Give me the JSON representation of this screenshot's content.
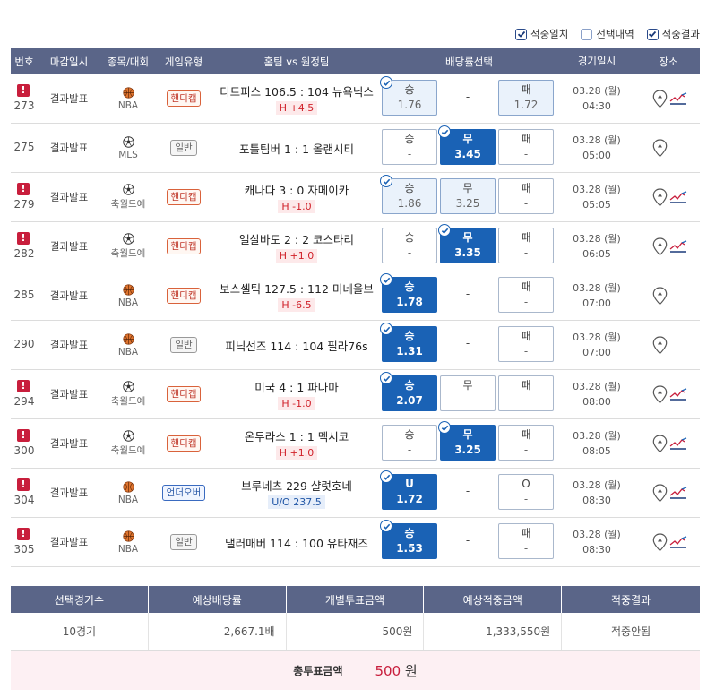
{
  "legend": [
    {
      "label": "적중일치",
      "checked": true
    },
    {
      "label": "선택내역",
      "checked": false
    },
    {
      "label": "적중결과",
      "checked": true
    }
  ],
  "headers": [
    "번호",
    "마감일시",
    "종목/대회",
    "게임유형",
    "홈팀 vs 원정팀",
    "배당률선택",
    "경기일시",
    "장소"
  ],
  "rows": [
    {
      "no": "273",
      "warn": "!",
      "state": "결과발표",
      "sport": "basketball",
      "league": "NBA",
      "type": "핸디캡",
      "typeStyle": "handi",
      "match": "디트피스 106.5 : 104 뉴욕닉스",
      "line": "H +4.5",
      "lineStyle": "red",
      "win": {
        "label": "승",
        "value": "1.76",
        "style": "pick",
        "check": true
      },
      "draw": {
        "label": "-",
        "value": ""
      },
      "lose": {
        "label": "패",
        "value": "1.72",
        "style": "pick",
        "check": false
      },
      "date": "03.28 (월)",
      "time": "04:30",
      "trend": true
    },
    {
      "no": "275",
      "warn": "",
      "state": "결과발표",
      "sport": "soccer",
      "league": "MLS",
      "type": "일반",
      "typeStyle": "normal",
      "match": "포틀팀버 1 : 1 올랜시티",
      "line": "",
      "lineStyle": "",
      "win": {
        "label": "승",
        "value": "-",
        "style": "",
        "check": false
      },
      "draw": {
        "label": "무",
        "value": "3.45",
        "style": "sel",
        "check": true
      },
      "lose": {
        "label": "패",
        "value": "-",
        "style": "",
        "check": false
      },
      "date": "03.28 (월)",
      "time": "05:00",
      "trend": false
    },
    {
      "no": "279",
      "warn": "!",
      "state": "결과발표",
      "sport": "soccer",
      "league": "축월드예",
      "type": "핸디캡",
      "typeStyle": "handi",
      "match": "캐나다 3 : 0 자메이카",
      "line": "H -1.0",
      "lineStyle": "red",
      "win": {
        "label": "승",
        "value": "1.86",
        "style": "pick",
        "check": true
      },
      "draw": {
        "label": "무",
        "value": "3.25",
        "style": "pick",
        "check": false
      },
      "lose": {
        "label": "패",
        "value": "-",
        "style": "",
        "check": false
      },
      "date": "03.28 (월)",
      "time": "05:05",
      "trend": true
    },
    {
      "no": "282",
      "warn": "!",
      "state": "결과발표",
      "sport": "soccer",
      "league": "축월드예",
      "type": "핸디캡",
      "typeStyle": "handi",
      "match": "엘살바도 2 : 2 코스타리",
      "line": "H +1.0",
      "lineStyle": "red",
      "win": {
        "label": "승",
        "value": "-",
        "style": "",
        "check": false
      },
      "draw": {
        "label": "무",
        "value": "3.35",
        "style": "sel",
        "check": true
      },
      "lose": {
        "label": "패",
        "value": "-",
        "style": "",
        "check": false
      },
      "date": "03.28 (월)",
      "time": "06:05",
      "trend": true
    },
    {
      "no": "285",
      "warn": "",
      "state": "결과발표",
      "sport": "basketball",
      "league": "NBA",
      "type": "핸디캡",
      "typeStyle": "handi",
      "match": "보스셀틱 127.5 : 112 미네울브",
      "line": "H -6.5",
      "lineStyle": "red",
      "win": {
        "label": "승",
        "value": "1.78",
        "style": "sel",
        "check": true
      },
      "draw": {
        "label": "-",
        "value": ""
      },
      "lose": {
        "label": "패",
        "value": "-",
        "style": "",
        "check": false
      },
      "date": "03.28 (월)",
      "time": "07:00",
      "trend": false
    },
    {
      "no": "290",
      "warn": "",
      "state": "결과발표",
      "sport": "basketball",
      "league": "NBA",
      "type": "일반",
      "typeStyle": "normal",
      "match": "피닉선즈 114 : 104 필라76s",
      "line": "",
      "lineStyle": "",
      "win": {
        "label": "승",
        "value": "1.31",
        "style": "sel",
        "check": true
      },
      "draw": {
        "label": "-",
        "value": ""
      },
      "lose": {
        "label": "패",
        "value": "-",
        "style": "",
        "check": false
      },
      "date": "03.28 (월)",
      "time": "07:00",
      "trend": false
    },
    {
      "no": "294",
      "warn": "!",
      "state": "결과발표",
      "sport": "soccer",
      "league": "축월드예",
      "type": "핸디캡",
      "typeStyle": "handi",
      "match": "미국 4 : 1 파나마",
      "line": "H -1.0",
      "lineStyle": "red",
      "win": {
        "label": "승",
        "value": "2.07",
        "style": "sel",
        "check": true
      },
      "draw": {
        "label": "무",
        "value": "-",
        "style": "",
        "check": false
      },
      "lose": {
        "label": "패",
        "value": "-",
        "style": "",
        "check": false
      },
      "date": "03.28 (월)",
      "time": "08:00",
      "trend": true
    },
    {
      "no": "300",
      "warn": "!",
      "state": "결과발표",
      "sport": "soccer",
      "league": "축월드예",
      "type": "핸디캡",
      "typeStyle": "handi",
      "match": "온두라스 1 : 1 멕시코",
      "line": "H +1.0",
      "lineStyle": "red",
      "win": {
        "label": "승",
        "value": "-",
        "style": "",
        "check": false
      },
      "draw": {
        "label": "무",
        "value": "3.25",
        "style": "sel",
        "check": true
      },
      "lose": {
        "label": "패",
        "value": "-",
        "style": "",
        "check": false
      },
      "date": "03.28 (월)",
      "time": "08:05",
      "trend": true
    },
    {
      "no": "304",
      "warn": "!",
      "state": "결과발표",
      "sport": "basketball",
      "league": "NBA",
      "type": "언더오버",
      "typeStyle": "ou",
      "match": "브루네츠  229  샬럿호네",
      "line": "U/O 237.5",
      "lineStyle": "blue",
      "win": {
        "label": "U",
        "value": "1.72",
        "style": "sel",
        "check": true
      },
      "draw": {
        "label": "-",
        "value": ""
      },
      "lose": {
        "label": "O",
        "value": "-",
        "style": "",
        "check": false
      },
      "date": "03.28 (월)",
      "time": "08:30",
      "trend": true
    },
    {
      "no": "305",
      "warn": "!",
      "state": "결과발표",
      "sport": "basketball",
      "league": "NBA",
      "type": "일반",
      "typeStyle": "normal",
      "match": "댈러매버 114 : 100 유타재즈",
      "line": "",
      "lineStyle": "",
      "win": {
        "label": "승",
        "value": "1.53",
        "style": "sel",
        "check": true
      },
      "draw": {
        "label": "-",
        "value": ""
      },
      "lose": {
        "label": "패",
        "value": "-",
        "style": "",
        "check": false
      },
      "date": "03.28 (월)",
      "time": "08:30",
      "trend": true
    }
  ],
  "summary": {
    "headers": [
      "선택경기수",
      "예상배당률",
      "개별투표금액",
      "예상적중금액",
      "적중결과"
    ],
    "values": [
      "10경기",
      "2,667.1배",
      "500원",
      "1,333,550원",
      "적중안됨"
    ],
    "total_label": "총투표금액",
    "total_amount": "500",
    "total_unit": "원"
  },
  "colors": {
    "header": "#5a6588",
    "selected": "#1a62b5",
    "warn": "#c81e3c",
    "handicap": "#d9623b"
  }
}
